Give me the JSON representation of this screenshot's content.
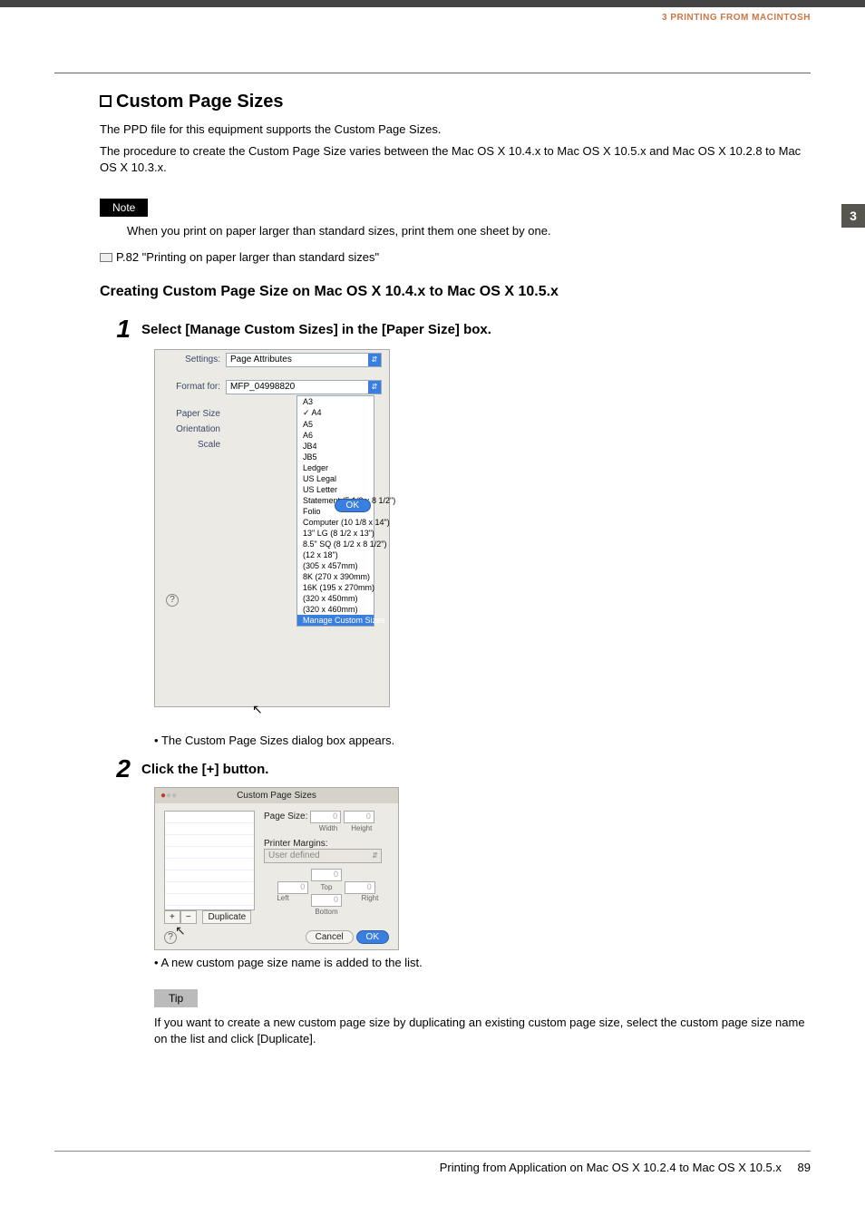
{
  "header": {
    "chapter_label": "3 PRINTING FROM MACINTOSH",
    "chapter_tab": "3"
  },
  "section": {
    "title": "Custom Page Sizes",
    "intro1": "The PPD file for this equipment supports the Custom Page Sizes.",
    "intro2": "The procedure to create the Custom Page Size varies between the Mac OS X 10.4.x to Mac OS X 10.5.x and Mac OS X 10.2.8 to Mac OS X 10.3.x."
  },
  "note": {
    "label": "Note",
    "text": "When you print on paper larger than standard sizes, print them one sheet by one."
  },
  "xref": {
    "text": "P.82 \"Printing on paper larger than standard sizes\""
  },
  "subsection": {
    "title": "Creating Custom Page Size on Mac OS X 10.4.x to Mac OS X 10.5.x"
  },
  "steps": {
    "1": {
      "num": "1",
      "text": "Select [Manage Custom Sizes] in the [Paper Size] box.",
      "result": "The Custom Page Sizes dialog box appears."
    },
    "2": {
      "num": "2",
      "text": "Click the [+] button.",
      "result": "A new custom page size name is added to the list."
    }
  },
  "tip": {
    "label": "Tip",
    "text": "If you want to create a new custom page size by duplicating an existing custom page size, select the custom page size name on the list and click [Duplicate]."
  },
  "shot1": {
    "labels": {
      "settings": "Settings:",
      "format_for": "Format for:",
      "paper_size": "Paper Size",
      "orientation": "Orientation",
      "scale": "Scale"
    },
    "settings_value": "Page Attributes",
    "format_for_value": "MFP_04998820",
    "selected": "A4",
    "options": [
      "A3",
      "A4",
      "A5",
      "A6",
      "JB4",
      "JB5",
      "Ledger",
      "US Legal",
      "US Letter",
      "Statement (5 1/2 x 8 1/2\")",
      "Folio",
      "Computer (10 1/8 x 14\")",
      "13\" LG (8 1/2 x 13\")",
      "8.5\" SQ (8 1/2 x 8 1/2\")",
      "(12 x 18\")",
      "(305 x 457mm)",
      "8K (270 x 390mm)",
      "16K (195 x 270mm)",
      "(320 x 450mm)",
      "(320 x 460mm)",
      "Manage Custom Sizes"
    ],
    "highlight": "Manage Custom Sizes",
    "ok": "OK"
  },
  "shot2": {
    "title": "Custom Page Sizes",
    "page_size_label": "Page Size:",
    "width_label": "Width",
    "height_label": "Height",
    "printer_margins_label": "Printer Margins:",
    "margins_preset": "User defined",
    "top_label": "Top",
    "bottom_label": "Bottom",
    "left_label": "Left",
    "right_label": "Right",
    "zero": "0",
    "plus": "+",
    "minus": "−",
    "duplicate": "Duplicate",
    "cancel": "Cancel",
    "ok": "OK"
  },
  "footer": {
    "text": "Printing from Application on Mac OS X 10.2.4 to Mac OS X 10.5.x",
    "page": "89"
  }
}
